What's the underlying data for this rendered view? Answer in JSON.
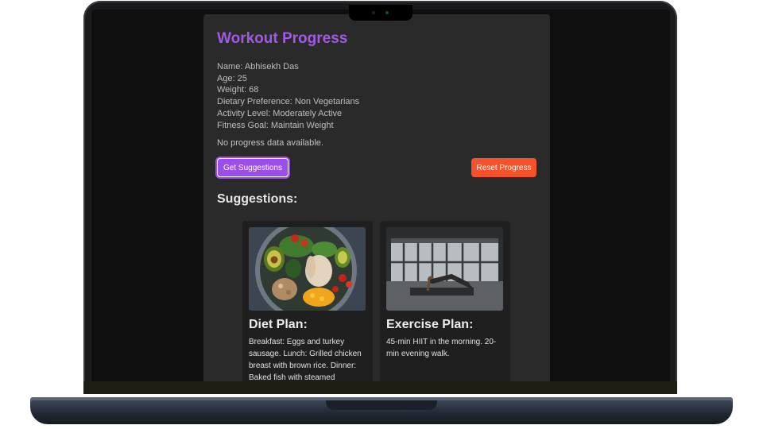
{
  "app": {
    "title": "Workout Progress"
  },
  "profile": {
    "name": "Name: Abhisekh Das",
    "age": "Age: 25",
    "weight": "Weight: 68",
    "diet": "Dietary Preference: Non Vegetarians",
    "activity": "Activity Level: Moderately Active",
    "goal": "Fitness Goal: Maintain Weight"
  },
  "status": {
    "progress_message": "No progress data available."
  },
  "actions": {
    "suggest_label": "Get Suggestions",
    "reset_label": "Reset Progress"
  },
  "suggestions": {
    "heading": "Suggestions:",
    "diet": {
      "title": "Diet Plan:",
      "text": "Breakfast: Eggs and turkey sausage. Lunch: Grilled chicken breast with brown rice. Dinner: Baked fish with steamed"
    },
    "exercise": {
      "title": "Exercise Plan:",
      "text": "45-min HIIT in the morning. 20-min evening walk."
    }
  },
  "colors": {
    "accent": "#a259e6",
    "suggest_button": "#9b4fe8",
    "reset_button": "#f5512a",
    "panel": "#2a2a2a"
  }
}
